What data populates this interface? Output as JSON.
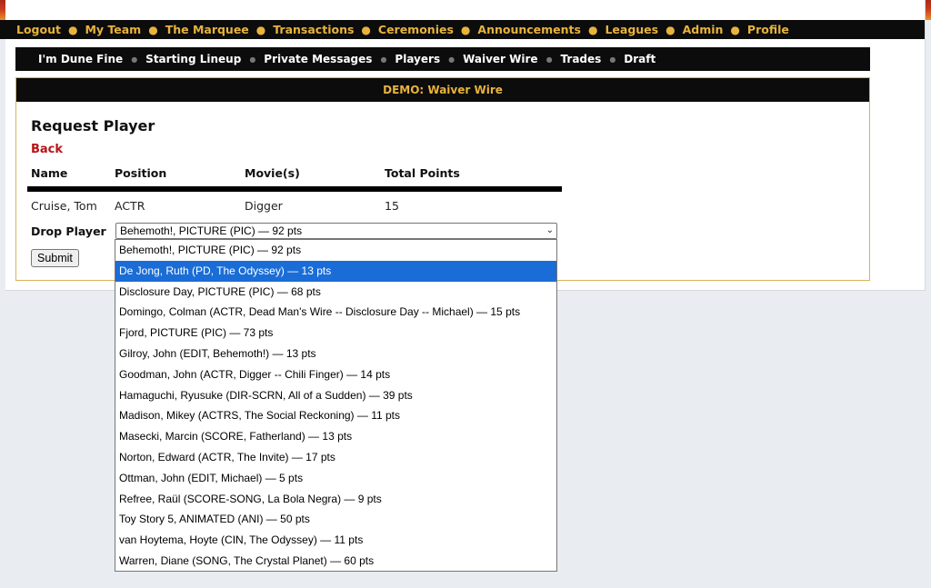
{
  "main_nav": [
    "Logout",
    "My Team",
    "The Marquee",
    "Transactions",
    "Ceremonies",
    "Announcements",
    "Leagues",
    "Admin",
    "Profile"
  ],
  "sub_nav": [
    "I'm Dune Fine",
    "Starting Lineup",
    "Private Messages",
    "Players",
    "Waiver Wire",
    "Trades",
    "Draft"
  ],
  "section_header": "DEMO: Waiver Wire",
  "page_title": "Request Player",
  "back_label": "Back",
  "columns": [
    "Name",
    "Position",
    "Movie(s)",
    "Total Points"
  ],
  "player_row": [
    "Cruise, Tom",
    "ACTR",
    "Digger",
    "15"
  ],
  "drop_label": "Drop Player",
  "selected_value": "Behemoth!, PICTURE (PIC) — 92 pts",
  "submit_label": "Submit",
  "highlighted_index": 1,
  "options": [
    "Behemoth!, PICTURE (PIC) — 92 pts",
    "De Jong, Ruth (PD, The Odyssey) — 13 pts",
    "Disclosure Day, PICTURE (PIC) — 68 pts",
    "Domingo, Colman (ACTR, Dead Man's Wire -- Disclosure Day -- Michael) — 15 pts",
    "Fjord, PICTURE (PIC) — 73 pts",
    "Gilroy, John (EDIT, Behemoth!) — 13 pts",
    "Goodman, John (ACTR, Digger -- Chili Finger) — 14 pts",
    "Hamaguchi, Ryusuke (DIR-SCRN, All of a Sudden) — 39 pts",
    "Madison, Mikey (ACTRS, The Social Reckoning) — 11 pts",
    "Masecki, Marcin (SCORE, Fatherland) — 13 pts",
    "Norton, Edward (ACTR, The Invite) — 17 pts",
    "Ottman, John (EDIT, Michael) — 5 pts",
    "Refree, Raül (SCORE-SONG, La Bola Negra) — 9 pts",
    "Toy Story 5, ANIMATED (ANI) — 50 pts",
    "van Hoytema, Hoyte (CIN, The Odyssey) — 11 pts",
    "Warren, Diane (SONG, The Crystal Planet) — 60 pts"
  ],
  "colors": {
    "nav_bg": "#0c0c0c",
    "nav_gold": "#e8b33c",
    "back_red": "#b81418",
    "highlight": "#1a6dd6",
    "box_border": "#d7b35a"
  }
}
